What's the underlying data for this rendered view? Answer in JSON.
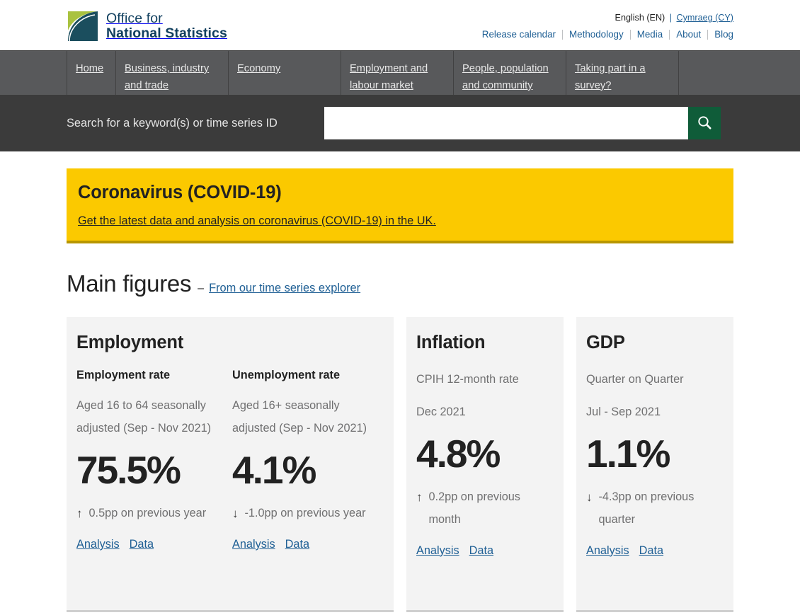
{
  "header": {
    "logo": {
      "line1": "Office for",
      "line2": "National Statistics",
      "icon": "ons-logo-icon",
      "color_dark": "#1b4e5e",
      "color_green": "#a9c23f"
    },
    "language": {
      "current": "English (EN)",
      "separator": "|",
      "alternate": "Cymraeg (CY)"
    },
    "util_links": [
      {
        "label": "Release calendar"
      },
      {
        "label": "Methodology"
      },
      {
        "label": "Media"
      },
      {
        "label": "About"
      },
      {
        "label": "Blog"
      }
    ]
  },
  "primary_nav": {
    "items": [
      {
        "label": "Home"
      },
      {
        "label": "Business, industry and trade"
      },
      {
        "label": "Economy"
      },
      {
        "label": "Employment and labour market"
      },
      {
        "label": "People, population and community"
      },
      {
        "label": "Taking part in a survey?"
      }
    ]
  },
  "search": {
    "label": "Search for a keyword(s) or time series ID",
    "value": "",
    "placeholder": "",
    "button_icon": "search-icon",
    "button_color": "#0f5c39"
  },
  "covid_banner": {
    "title": "Coronavirus (COVID-19)",
    "link": "Get the latest data and analysis on coronavirus (COVID-19) in the UK.",
    "background": "#fbc900",
    "border": "#b89600"
  },
  "main_figures": {
    "title": "Main figures",
    "dash": "–",
    "link": "From our time series explorer"
  },
  "cards": [
    {
      "title": "Employment",
      "metrics": [
        {
          "heading": "Employment rate",
          "description": "Aged 16 to 64 seasonally adjusted (Sep - Nov 2021)",
          "value": "75.5%",
          "arrow": "↑",
          "direction": "up",
          "change": "0.5pp on previous year",
          "analysis_label": "Analysis",
          "data_label": "Data"
        },
        {
          "heading": "Unemployment rate",
          "description": "Aged 16+ seasonally adjusted (Sep - Nov 2021)",
          "value": "4.1%",
          "arrow": "↓",
          "direction": "down",
          "change": "-1.0pp on previous year",
          "analysis_label": "Analysis",
          "data_label": "Data"
        }
      ]
    },
    {
      "title": "Inflation",
      "metrics": [
        {
          "heading": "",
          "description_line1": "CPIH 12-month rate",
          "description_line2": "Dec 2021",
          "value": "4.8%",
          "arrow": "↑",
          "direction": "up",
          "change": "0.2pp on previous month",
          "analysis_label": "Analysis",
          "data_label": "Data"
        }
      ]
    },
    {
      "title": "GDP",
      "metrics": [
        {
          "heading": "",
          "description_line1": "Quarter on Quarter",
          "description_line2": "Jul - Sep 2021",
          "value": "1.1%",
          "arrow": "↓",
          "direction": "down",
          "change": "-4.3pp on previous quarter",
          "analysis_label": "Analysis",
          "data_label": "Data"
        }
      ]
    }
  ]
}
